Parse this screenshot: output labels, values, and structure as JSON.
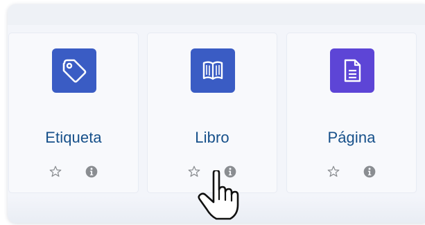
{
  "colors": {
    "panel_background": "#f3f5fa",
    "card_background": "#f8f9fc",
    "module_name_text": "#16508a",
    "etiqueta_icon_bg": "#3a5cc4",
    "libro_icon_bg": "#3a5cc4",
    "pagina_icon_bg": "#5d45d6",
    "action_icon": "#8a8d91"
  },
  "modules": [
    {
      "name": "Etiqueta",
      "icon": "tag-icon"
    },
    {
      "name": "Libro",
      "icon": "book-icon"
    },
    {
      "name": "Página",
      "icon": "page-document-icon"
    }
  ],
  "actions": {
    "star_icon": "star-outline-icon",
    "info_icon": "info-circle-icon"
  },
  "cursor": {
    "type": "hand-pointer-icon"
  }
}
